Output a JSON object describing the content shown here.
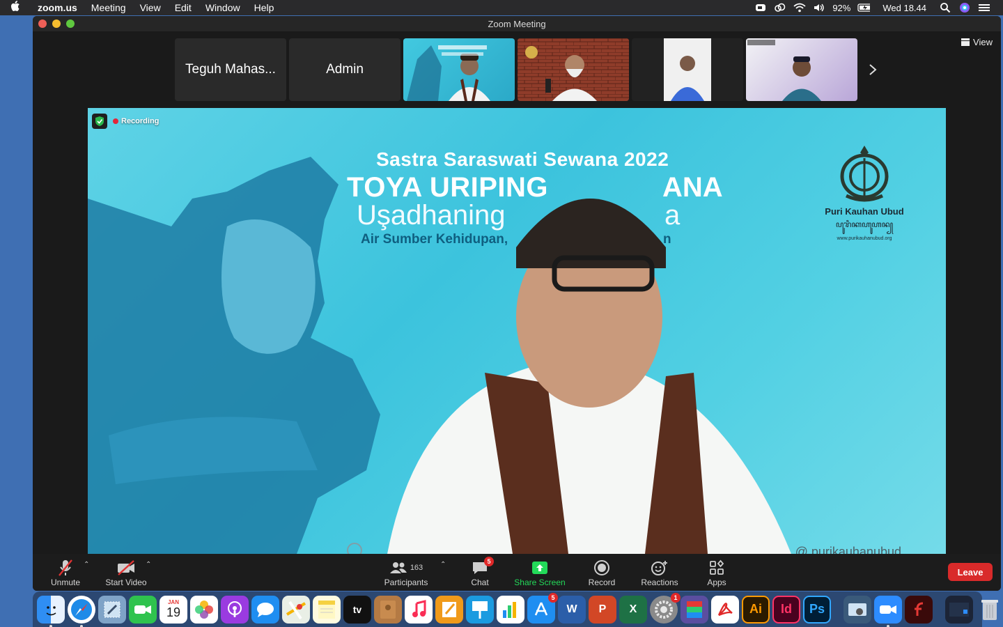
{
  "menubar": {
    "app_name": "zoom.us",
    "menus": [
      "Meeting",
      "View",
      "Edit",
      "Window",
      "Help"
    ],
    "battery": "92%",
    "clock": "Wed 18.44"
  },
  "window": {
    "title": "Zoom Meeting"
  },
  "thumbnails": [
    {
      "label": "Teguh Mahas..."
    },
    {
      "label": "Admin"
    }
  ],
  "view_button": "View",
  "main_video": {
    "recording_label": "Recording",
    "banner_line1": "Sastra Saraswati Sewana 2022",
    "banner_line2": "TOYA URIPING",
    "banner_line2b": "ANA",
    "banner_line3": "Uşadhaning",
    "banner_line3b": "a",
    "banner_line4": "Air Sumber Kehidupan,",
    "banner_line4b": "n",
    "crest_name": "Puri Kauhan Ubud",
    "crest_script": "ꦥꦸꦫꦶꦏꦲꦸꦲꦤ꧀",
    "crest_web": "www.purikauhanubud.org",
    "footer_handle": "purikauhanubud"
  },
  "toolbar": {
    "unmute": "Unmute",
    "start_video": "Start Video",
    "participants": "Participants",
    "participants_count": "163",
    "chat": "Chat",
    "chat_badge": "5",
    "share_screen": "Share Screen",
    "record": "Record",
    "reactions": "Reactions",
    "apps": "Apps",
    "leave": "Leave"
  },
  "dock": {
    "calendar_month": "JAN",
    "calendar_day": "19",
    "appstore_badge": "5",
    "settings_badge": "1",
    "tv_label": "tv",
    "ai_label": "Ai",
    "id_label": "Id",
    "ps_label": "Ps"
  },
  "colors": {
    "leave": "#d92a2a",
    "share_screen": "#23d959",
    "recording_dot": "#e3263a",
    "main_bg": "#3cc3dd"
  }
}
